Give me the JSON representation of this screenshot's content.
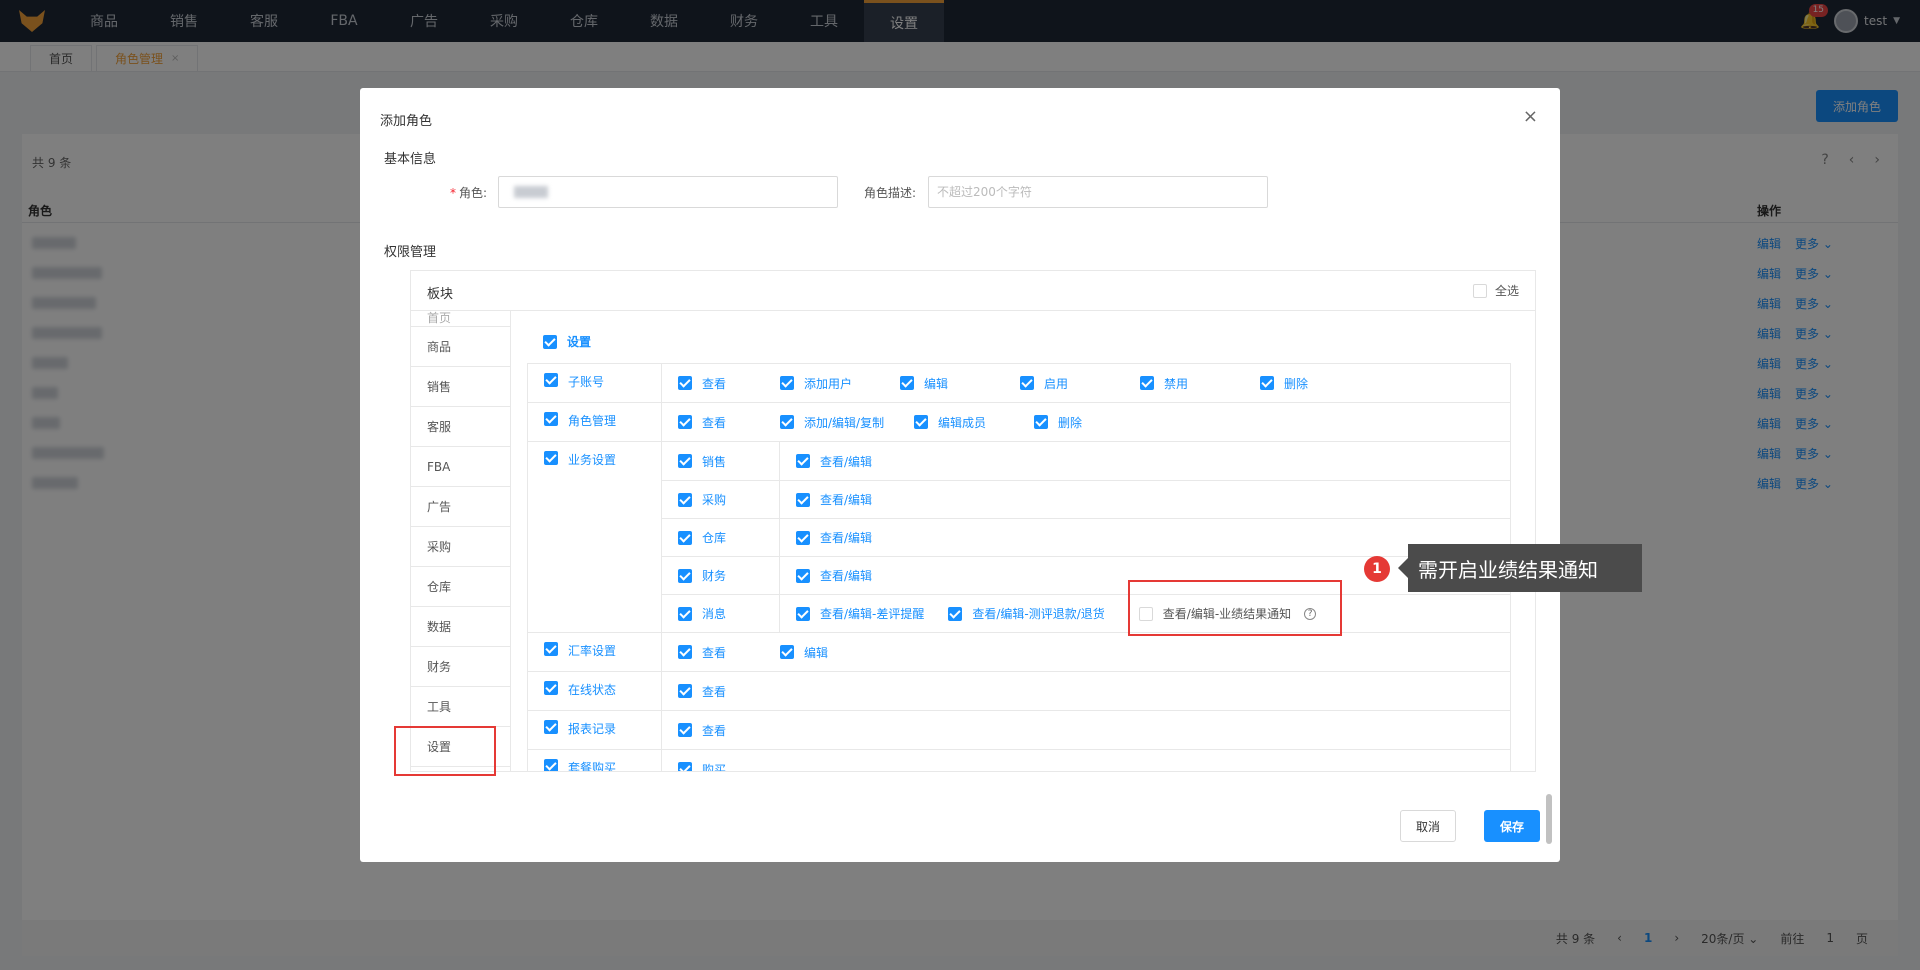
{
  "topnav": {
    "items": [
      "商品",
      "销售",
      "客服",
      "FBA",
      "广告",
      "采购",
      "仓库",
      "数据",
      "财务",
      "工具",
      "设置"
    ],
    "active_index": 10,
    "notification_count": "15",
    "username": "test"
  },
  "tabs": {
    "home": "首页",
    "current": "角色管理"
  },
  "background": {
    "add_button": "添加角色",
    "count": "共 9 条",
    "col_role": "角色",
    "col_op": "操作",
    "row_edit": "编辑",
    "row_more": "更多",
    "pager": {
      "total": "共 9 条",
      "current_page": "1",
      "page_size": "20条/页",
      "goto": "前往",
      "goto_page": "1",
      "page_suffix": "页"
    }
  },
  "modal": {
    "title": "添加角色",
    "basic_info": "基本信息",
    "role_label": "角色:",
    "desc_label": "角色描述:",
    "desc_placeholder": "不超过200个字符",
    "perm_title": "权限管理",
    "panel_title": "板块",
    "select_all": "全选",
    "sidebar": [
      "首页",
      "商品",
      "销售",
      "客服",
      "FBA",
      "广告",
      "采购",
      "仓库",
      "数据",
      "财务",
      "工具",
      "设置"
    ],
    "group_title": "设置",
    "rows": {
      "sub_account": {
        "name": "子账号",
        "opts": [
          "查看",
          "添加用户",
          "编辑",
          "启用",
          "禁用",
          "删除"
        ]
      },
      "role_mgmt": {
        "name": "角色管理",
        "opts": [
          "查看",
          "添加/编辑/复制",
          "编辑成员",
          "删除"
        ]
      },
      "business": {
        "name": "业务设置",
        "subs": [
          {
            "name": "销售",
            "opts": [
              "查看/编辑"
            ]
          },
          {
            "name": "采购",
            "opts": [
              "查看/编辑"
            ]
          },
          {
            "name": "仓库",
            "opts": [
              "查看/编辑"
            ]
          },
          {
            "name": "财务",
            "opts": [
              "查看/编辑"
            ]
          },
          {
            "name": "消息",
            "opts": [
              "查看/编辑-差评提醒",
              "查看/编辑-测评退款/退货",
              "查看/编辑-业绩结果通知"
            ]
          }
        ]
      },
      "exchange": {
        "name": "汇率设置",
        "opts": [
          "查看",
          "编辑"
        ]
      },
      "online": {
        "name": "在线状态",
        "opts": [
          "查看"
        ]
      },
      "report": {
        "name": "报表记录",
        "opts": [
          "查看"
        ]
      },
      "package": {
        "name": "套餐购买",
        "opts": [
          "购买"
        ]
      }
    },
    "cancel": "取消",
    "save": "保存"
  },
  "annotation": {
    "number": "1",
    "text": "需开启业绩结果通知"
  }
}
